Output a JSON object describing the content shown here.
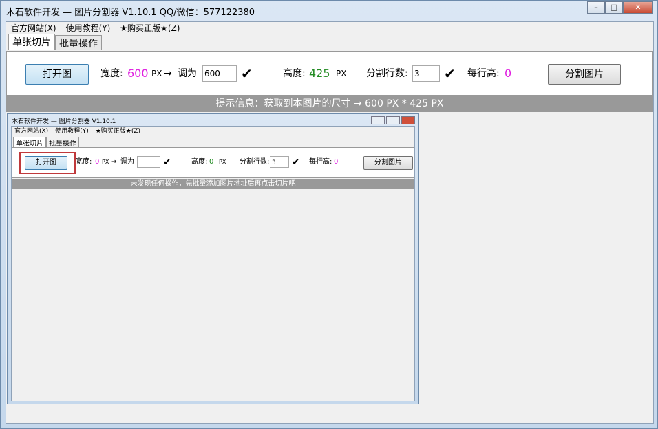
{
  "window": {
    "title": "木石软件开发 — 图片分割器 V1.10.1    QQ/微信：577122380",
    "min": "–",
    "max": "□",
    "close": "✕"
  },
  "menu": [
    "官方网站(X)",
    "使用教程(Y)",
    "★购买正版★(Z)"
  ],
  "tabs": [
    "单张切片",
    "批量操作"
  ],
  "controls": {
    "open": "打开图",
    "width_label": "宽度:",
    "width_value": "600",
    "px": "PX",
    "arrow": "→",
    "resize_label": "调为",
    "resize_value": "600",
    "check": "✔",
    "height_label": "高度:",
    "height_value": "425",
    "rows_label": "分割行数:",
    "rows_value": "3",
    "row_height_label": "每行高:",
    "row_height_value": "0",
    "split": "分割图片"
  },
  "status": "提示信息：获取到本图片的尺寸 → 600 PX * 425 PX",
  "embedded": {
    "title": "木石软件开发 — 图片分割器 V1.10.1",
    "width_value": "0",
    "resize_value": "",
    "height_value": "0",
    "rows_value": "3",
    "row_height_value": "0",
    "status": "未发现任何操作，先批量添加图片地址后再点击切片吧"
  },
  "colors": {
    "width": "#e020e0",
    "height": "#228b22",
    "status_bg": "#999999",
    "highlight": "#c0393b"
  }
}
